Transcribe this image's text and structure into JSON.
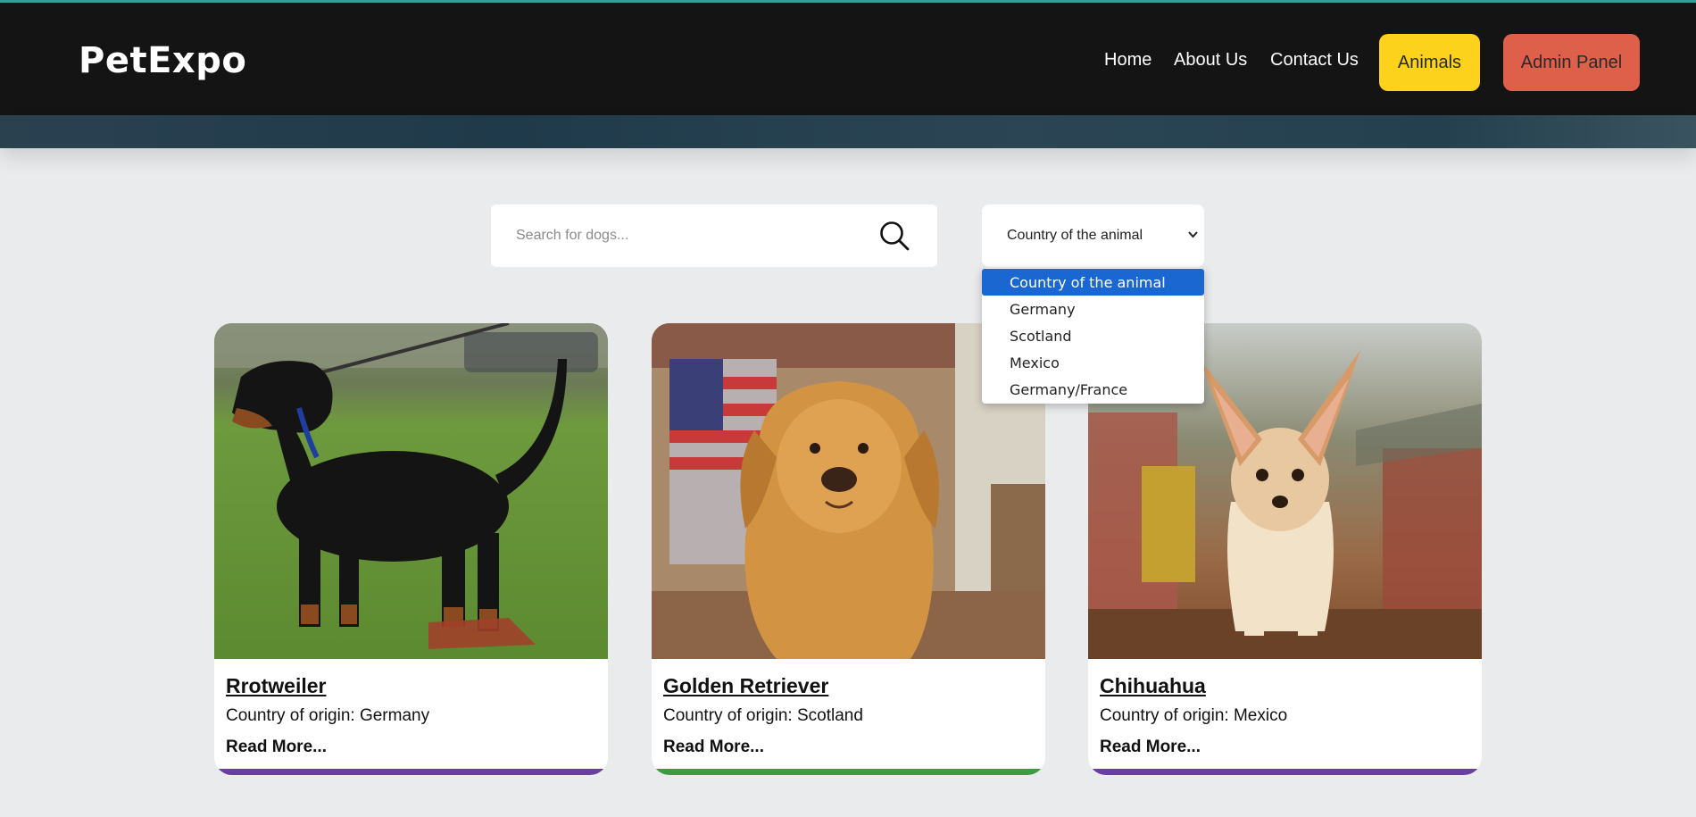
{
  "brand": {
    "logo": "PetExpo"
  },
  "nav": {
    "links": [
      "Home",
      "About Us",
      "Contact Us"
    ],
    "animals_button": "Animals",
    "admin_button": "Admin Panel"
  },
  "search": {
    "placeholder": "Search for dogs...",
    "value": "",
    "icon": "search-icon"
  },
  "country_filter": {
    "selected": "Country of the animal",
    "options": [
      "Country of the animal",
      "Germany",
      "Scotland",
      "Mexico",
      "Germany/France"
    ]
  },
  "cards": [
    {
      "title": "Rrotweiler",
      "country": "Country of origin: Germany",
      "read_more": "Read More...",
      "bar_color": "#6a3da0"
    },
    {
      "title": "Golden Retriever",
      "country": "Country of origin: Scotland",
      "read_more": "Read More...",
      "bar_color": "#3f9a46"
    },
    {
      "title": "Chihuahua",
      "country": "Country of origin: Mexico",
      "read_more": "Read More...",
      "bar_color": "#6a3da0"
    }
  ],
  "colors": {
    "navbar": "#141414",
    "animals_button": "#fcd21c",
    "admin_button": "#de5f4a",
    "dropdown_selected": "#1a67d2",
    "page_background": "#eaebec"
  }
}
